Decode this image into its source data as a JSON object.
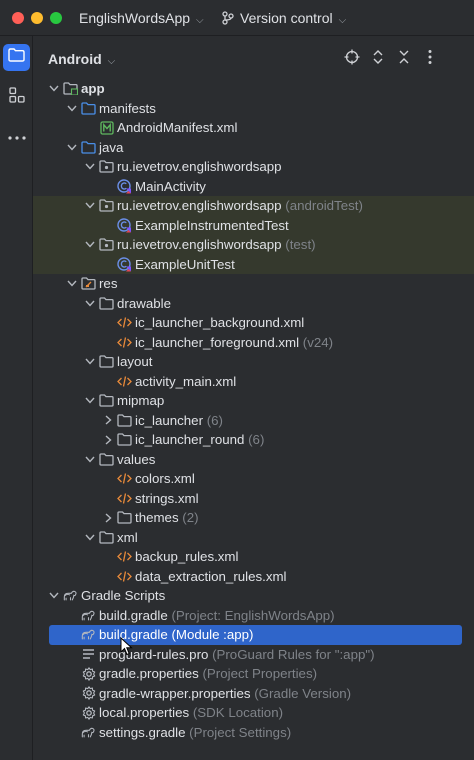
{
  "window": {
    "project_name": "EnglishWordsApp",
    "vcs_label": "Version control",
    "traffic_light_colors": [
      "#ff5f57",
      "#febc2e",
      "#28c840"
    ]
  },
  "sidebar": {
    "icons": [
      "folder-icon",
      "structure-icon",
      "more-icon"
    ]
  },
  "panel": {
    "title": "Android",
    "header_icons": [
      "locate-icon",
      "expand-collapse-icon",
      "close-collapse-icon",
      "more-icon"
    ]
  },
  "colors": {
    "selection": "#2f65ca",
    "test_highlight": "#35392d",
    "folder_blue": "#4a8fe8",
    "xml_orange": "#e88a3a",
    "manifest_green": "#5fb85f"
  },
  "tree": [
    {
      "id": "app",
      "indent": 0,
      "arrow": "down",
      "icon": "module-folder-icon",
      "label": "app",
      "extra": "",
      "bold": true,
      "hl": false,
      "sel": false
    },
    {
      "id": "manifests",
      "indent": 1,
      "arrow": "down",
      "icon": "folder-blue-icon",
      "label": "manifests",
      "extra": "",
      "hl": false,
      "sel": false
    },
    {
      "id": "android-manifest",
      "indent": 2,
      "arrow": "none",
      "icon": "manifest-icon",
      "label": "AndroidManifest.xml",
      "extra": "",
      "hl": false,
      "sel": false
    },
    {
      "id": "java",
      "indent": 1,
      "arrow": "down",
      "icon": "folder-blue-icon",
      "label": "java",
      "extra": "",
      "hl": false,
      "sel": false
    },
    {
      "id": "pkg-main",
      "indent": 2,
      "arrow": "down",
      "icon": "package-folder-icon",
      "label": "ru.ievetrov.englishwordsapp",
      "extra": "",
      "hl": false,
      "sel": false
    },
    {
      "id": "main-activity",
      "indent": 3,
      "arrow": "none",
      "icon": "kotlin-class-icon",
      "label": "MainActivity",
      "extra": "",
      "hl": false,
      "sel": false
    },
    {
      "id": "pkg-androidtest",
      "indent": 2,
      "arrow": "down",
      "icon": "package-folder-icon",
      "label": "ru.ievetrov.englishwordsapp",
      "extra": "(androidTest)",
      "hl": true,
      "sel": false
    },
    {
      "id": "example-instrumented-test",
      "indent": 3,
      "arrow": "none",
      "icon": "kotlin-class-icon",
      "label": "ExampleInstrumentedTest",
      "extra": "",
      "hl": true,
      "sel": false
    },
    {
      "id": "pkg-test",
      "indent": 2,
      "arrow": "down",
      "icon": "package-folder-icon",
      "label": "ru.ievetrov.englishwordsapp",
      "extra": "(test)",
      "hl": true,
      "sel": false
    },
    {
      "id": "example-unit-test",
      "indent": 3,
      "arrow": "none",
      "icon": "kotlin-class-icon",
      "label": "ExampleUnitTest",
      "extra": "",
      "hl": true,
      "sel": false
    },
    {
      "id": "res",
      "indent": 1,
      "arrow": "down",
      "icon": "res-folder-icon",
      "label": "res",
      "extra": "",
      "hl": false,
      "sel": false
    },
    {
      "id": "drawable",
      "indent": 2,
      "arrow": "down",
      "icon": "folder-gray-icon",
      "label": "drawable",
      "extra": "",
      "hl": false,
      "sel": false
    },
    {
      "id": "ic-launcher-background",
      "indent": 3,
      "arrow": "none",
      "icon": "xml-icon",
      "label": "ic_launcher_background.xml",
      "extra": "",
      "hl": false,
      "sel": false
    },
    {
      "id": "ic-launcher-foreground",
      "indent": 3,
      "arrow": "none",
      "icon": "xml-icon",
      "label": "ic_launcher_foreground.xml",
      "extra": "(v24)",
      "hl": false,
      "sel": false
    },
    {
      "id": "layout",
      "indent": 2,
      "arrow": "down",
      "icon": "folder-gray-icon",
      "label": "layout",
      "extra": "",
      "hl": false,
      "sel": false
    },
    {
      "id": "activity-main",
      "indent": 3,
      "arrow": "none",
      "icon": "xml-icon",
      "label": "activity_main.xml",
      "extra": "",
      "hl": false,
      "sel": false
    },
    {
      "id": "mipmap",
      "indent": 2,
      "arrow": "down",
      "icon": "folder-gray-icon",
      "label": "mipmap",
      "extra": "",
      "hl": false,
      "sel": false
    },
    {
      "id": "ic-launcher",
      "indent": 3,
      "arrow": "right",
      "icon": "folder-gray-icon",
      "label": "ic_launcher",
      "extra": "(6)",
      "hl": false,
      "sel": false
    },
    {
      "id": "ic-launcher-round",
      "indent": 3,
      "arrow": "right",
      "icon": "folder-gray-icon",
      "label": "ic_launcher_round",
      "extra": "(6)",
      "hl": false,
      "sel": false
    },
    {
      "id": "values",
      "indent": 2,
      "arrow": "down",
      "icon": "folder-gray-icon",
      "label": "values",
      "extra": "",
      "hl": false,
      "sel": false
    },
    {
      "id": "colors-xml",
      "indent": 3,
      "arrow": "none",
      "icon": "xml-icon",
      "label": "colors.xml",
      "extra": "",
      "hl": false,
      "sel": false
    },
    {
      "id": "strings-xml",
      "indent": 3,
      "arrow": "none",
      "icon": "xml-icon",
      "label": "strings.xml",
      "extra": "",
      "hl": false,
      "sel": false
    },
    {
      "id": "themes",
      "indent": 3,
      "arrow": "right",
      "icon": "folder-gray-icon",
      "label": "themes",
      "extra": "(2)",
      "hl": false,
      "sel": false
    },
    {
      "id": "xml",
      "indent": 2,
      "arrow": "down",
      "icon": "folder-gray-icon",
      "label": "xml",
      "extra": "",
      "hl": false,
      "sel": false
    },
    {
      "id": "backup-rules",
      "indent": 3,
      "arrow": "none",
      "icon": "xml-icon",
      "label": "backup_rules.xml",
      "extra": "",
      "hl": false,
      "sel": false
    },
    {
      "id": "data-extraction-rules",
      "indent": 3,
      "arrow": "none",
      "icon": "xml-icon",
      "label": "data_extraction_rules.xml",
      "extra": "",
      "hl": false,
      "sel": false
    },
    {
      "id": "gradle-scripts",
      "indent": 0,
      "arrow": "down",
      "icon": "gradle-icon",
      "label": "Gradle Scripts",
      "extra": "",
      "hl": false,
      "sel": false
    },
    {
      "id": "build-gradle-project",
      "indent": 1,
      "arrow": "none",
      "icon": "gradle-icon",
      "label": "build.gradle",
      "extra": "(Project: EnglishWordsApp)",
      "hl": false,
      "sel": false
    },
    {
      "id": "build-gradle-module",
      "indent": 1,
      "arrow": "none",
      "icon": "gradle-icon",
      "label": "build.gradle (Module :app)",
      "extra": "",
      "hl": false,
      "sel": true
    },
    {
      "id": "proguard-rules",
      "indent": 1,
      "arrow": "none",
      "icon": "text-lines-icon",
      "label": "proguard-rules.pro",
      "extra": "(ProGuard Rules for \":app\")",
      "hl": false,
      "sel": false
    },
    {
      "id": "gradle-properties",
      "indent": 1,
      "arrow": "none",
      "icon": "settings-gear-icon",
      "label": "gradle.properties",
      "extra": "(Project Properties)",
      "hl": false,
      "sel": false
    },
    {
      "id": "gradle-wrapper-properties",
      "indent": 1,
      "arrow": "none",
      "icon": "settings-gear-icon",
      "label": "gradle-wrapper.properties",
      "extra": "(Gradle Version)",
      "hl": false,
      "sel": false
    },
    {
      "id": "local-properties",
      "indent": 1,
      "arrow": "none",
      "icon": "settings-gear-icon",
      "label": "local.properties",
      "extra": "(SDK Location)",
      "hl": false,
      "sel": false
    },
    {
      "id": "settings-gradle",
      "indent": 1,
      "arrow": "none",
      "icon": "gradle-icon",
      "label": "settings.gradle",
      "extra": "(Project Settings)",
      "hl": false,
      "sel": false
    }
  ]
}
